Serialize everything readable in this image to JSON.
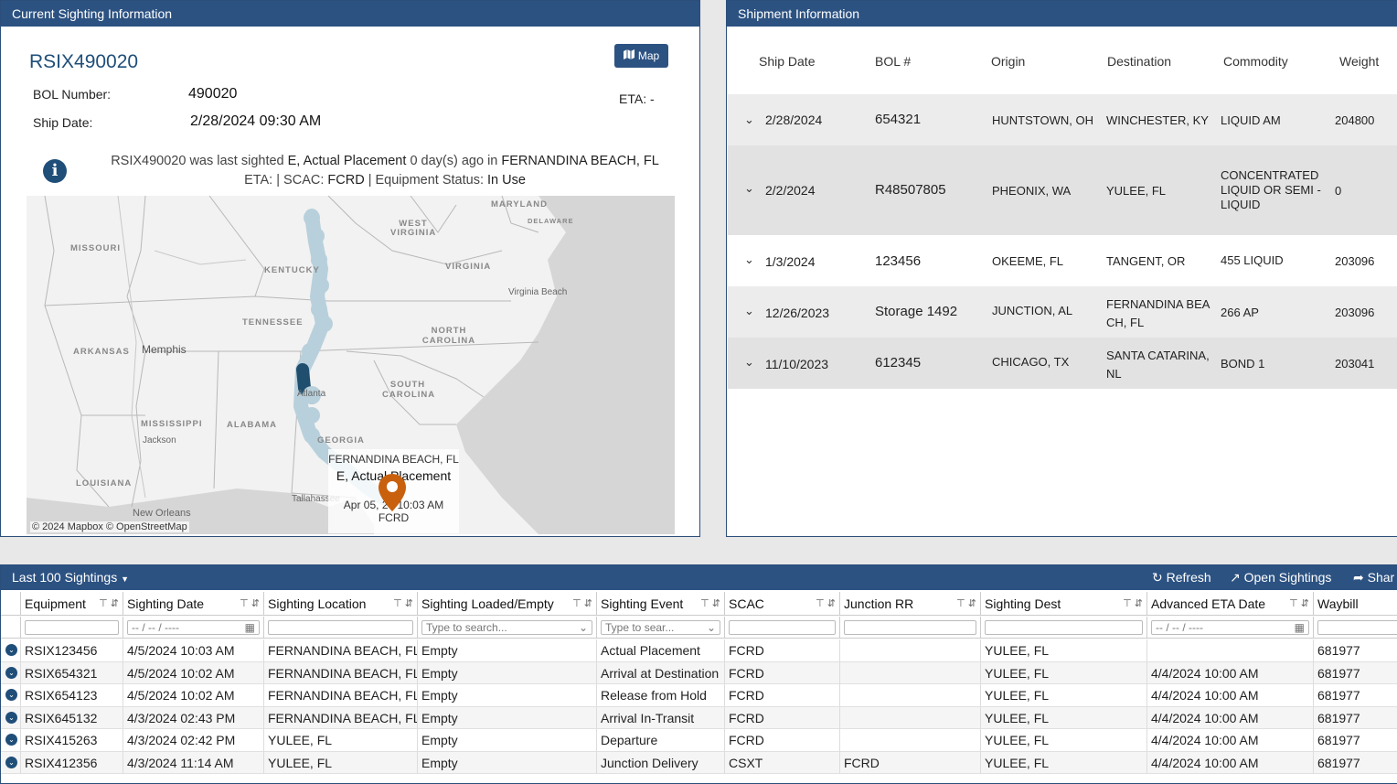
{
  "sighting_panel": {
    "title": "Current Sighting Information",
    "car_id": "RSIX490020",
    "map_button": "Map",
    "bol_label": "BOL Number:",
    "bol_value": "490020",
    "ship_date_label": "Ship Date:",
    "ship_date_value": "2/28/2024 09:30 AM",
    "eta_right": "ETA: -",
    "last_line1_pre": "RSIX490020 was last sighted",
    "last_line1_event": "E, Actual Placement",
    "last_line1_mid": "0 day(s) ago in",
    "last_line1_loc": "FERNANDINA BEACH, FL",
    "last_line2_eta": "ETA:",
    "last_line2_scac_label": "| SCAC:",
    "last_line2_scac": "FCRD",
    "last_line2_status_label": "| Equipment Status:",
    "last_line2_status": "In Use",
    "map": {
      "states": [
        "MISSOURI",
        "KENTUCKY",
        "WEST VIRGINIA",
        "VIRGINIA",
        "MARYLAND",
        "DELAWARE",
        "TENNESSEE",
        "NORTH CAROLINA",
        "ARKANSAS",
        "SOUTH CAROLINA",
        "MISSISSIPPI",
        "ALABAMA",
        "GEORGIA",
        "LOUISIANA"
      ],
      "cities": [
        "Memphis",
        "Virginia Beach",
        "Atlanta",
        "Jackson",
        "New Orleans",
        "Tallahassee"
      ],
      "attribution": "© 2024 Mapbox © OpenStreetMap",
      "popup_location": "FERNANDINA BEACH, FL",
      "popup_event": "E, Actual Placement",
      "popup_time": "Apr 05, 24 10:03 AM",
      "popup_scac": "FCRD",
      "pin_color": "#c8600e",
      "route_color": "#b8d0dc",
      "route_dark": "#1f4e6e"
    }
  },
  "shipment_panel": {
    "title": "Shipment Information",
    "columns": [
      "Ship Date",
      "BOL #",
      "Origin",
      "Destination",
      "Commodity",
      "Weight"
    ],
    "rows": [
      {
        "ship_date": "2/28/2024",
        "bol": "654321",
        "origin": "HUNTSTOWN, OH",
        "destination": "WINCHESTER, KY",
        "commodity": "LIQUID AM",
        "weight": "204800"
      },
      {
        "ship_date": "2/2/2024",
        "bol": "R48507805",
        "origin": "PHEONIX, WA",
        "destination": "YULEE, FL",
        "commodity": "CONCENTRATED LIQUID OR SEMI -LIQUID",
        "weight": "0"
      },
      {
        "ship_date": "1/3/2024",
        "bol": "123456",
        "origin": "OKEEME, FL",
        "destination": "TANGENT, OR",
        "commodity": "455 LIQUID",
        "weight": "203096"
      },
      {
        "ship_date": "12/26/2023",
        "bol": "Storage 1492",
        "origin": "JUNCTION, AL",
        "destination": "FERNANDINA BEACH, FL",
        "commodity": "266 AP",
        "weight": "203096"
      },
      {
        "ship_date": "11/10/2023",
        "bol": "612345",
        "origin": "CHICAGO, TX",
        "destination": "SANTA CATARINA, NL",
        "commodity": "BOND 1",
        "weight": "203041"
      }
    ]
  },
  "grid": {
    "title": "Last 100 Sightings",
    "refresh": "Refresh",
    "open_sightings": "Open Sightings",
    "share": "Shar",
    "columns": [
      "Equipment",
      "Sighting Date",
      "Sighting Location",
      "Sighting Loaded/Empty",
      "Sighting Event",
      "SCAC",
      "Junction RR",
      "Sighting Dest",
      "Advanced ETA Date",
      "Waybill"
    ],
    "filters": {
      "date_placeholder": "-- / -- / ----",
      "search_placeholder": "Type to search...",
      "search_placeholder_short": "Type to sear..."
    },
    "rows": [
      [
        "RSIX123456",
        "4/5/2024 10:03 AM",
        "FERNANDINA BEACH, FL",
        "Empty",
        "Actual Placement",
        "FCRD",
        "",
        "YULEE, FL",
        "",
        "681977"
      ],
      [
        "RSIX654321",
        "4/5/2024 10:02 AM",
        "FERNANDINA BEACH, FL",
        "Empty",
        "Arrival at Destination",
        "FCRD",
        "",
        "YULEE, FL",
        "4/4/2024 10:00 AM",
        "681977"
      ],
      [
        "RSIX654123",
        "4/5/2024 10:02 AM",
        "FERNANDINA BEACH, FL",
        "Empty",
        "Release from Hold",
        "FCRD",
        "",
        "YULEE, FL",
        "4/4/2024 10:00 AM",
        "681977"
      ],
      [
        "RSIX645132",
        "4/3/2024 02:43 PM",
        "FERNANDINA BEACH, FL",
        "Empty",
        "Arrival In-Transit",
        "FCRD",
        "",
        "YULEE, FL",
        "4/4/2024 10:00 AM",
        "681977"
      ],
      [
        "RSIX415263",
        "4/3/2024 02:42 PM",
        "YULEE, FL",
        "Empty",
        "Departure",
        "FCRD",
        "",
        "YULEE, FL",
        "4/4/2024 10:00 AM",
        "681977"
      ],
      [
        "RSIX412356",
        "4/3/2024 11:14 AM",
        "YULEE, FL",
        "Empty",
        "Junction Delivery",
        "CSXT",
        "FCRD",
        "YULEE, FL",
        "4/4/2024 10:00 AM",
        "681977"
      ]
    ]
  }
}
